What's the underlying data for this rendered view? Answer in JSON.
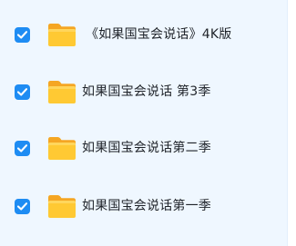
{
  "files": [
    {
      "name": "《如果国宝会说话》4K版",
      "checked": true,
      "icon": "folder-icon"
    },
    {
      "name": "如果国宝会说话 第3季",
      "checked": true,
      "icon": "folder-icon"
    },
    {
      "name": "如果国宝会说话第二季",
      "checked": true,
      "icon": "folder-icon"
    },
    {
      "name": "如果国宝会说话第一季",
      "checked": true,
      "icon": "folder-icon"
    }
  ],
  "colors": {
    "panel_background": "#eff7ff",
    "checkbox_accent": "#1e8cf3",
    "folder_yellow": "#ffc933",
    "folder_back": "#f5a623",
    "text": "#1f2329"
  }
}
